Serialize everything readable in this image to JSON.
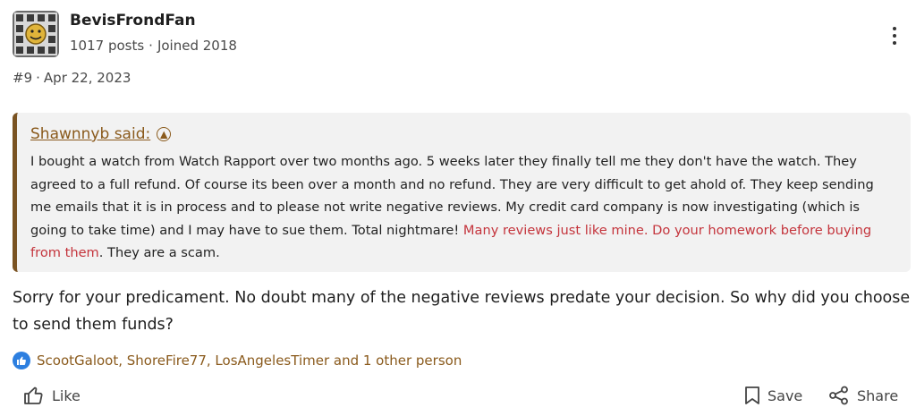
{
  "author": {
    "username": "BevisFrondFan",
    "posts": "1017 posts",
    "joined": "Joined 2018",
    "avatar_icon": "grid-face-avatar-icon"
  },
  "post": {
    "number": "#9",
    "date": "Apr 22, 2023"
  },
  "quote": {
    "author_label": "Shawnnyb said:",
    "text_before": "I bought a watch from Watch Rapport over two months ago. 5 weeks later they finally tell me they don't have the watch. They agreed to a full refund. Of course its been over a month and no refund. They are very difficult to get ahold of. They keep sending me emails that it is in process and to please not write negative reviews. My credit card company is now investigating (which is going to take time) and I may have to sue them. Total nightmare! ",
    "text_highlight": "Many reviews just like mine. Do your homework before buying from them",
    "text_after": ". They are a scam."
  },
  "reply_text": "Sorry for your predicament. No doubt many of the negative reviews predate your decision. So why did you choose to send them funds?",
  "reactions_text": "ScootGaloot, ShoreFire77, LosAngelesTimer and 1 other person",
  "actions": {
    "like": "Like",
    "save": "Save",
    "share": "Share"
  },
  "colors": {
    "accent": "#8a5a1c",
    "quote_border": "#7a5322",
    "highlight": "#c4343c",
    "like_badge": "#2d7fe0"
  }
}
